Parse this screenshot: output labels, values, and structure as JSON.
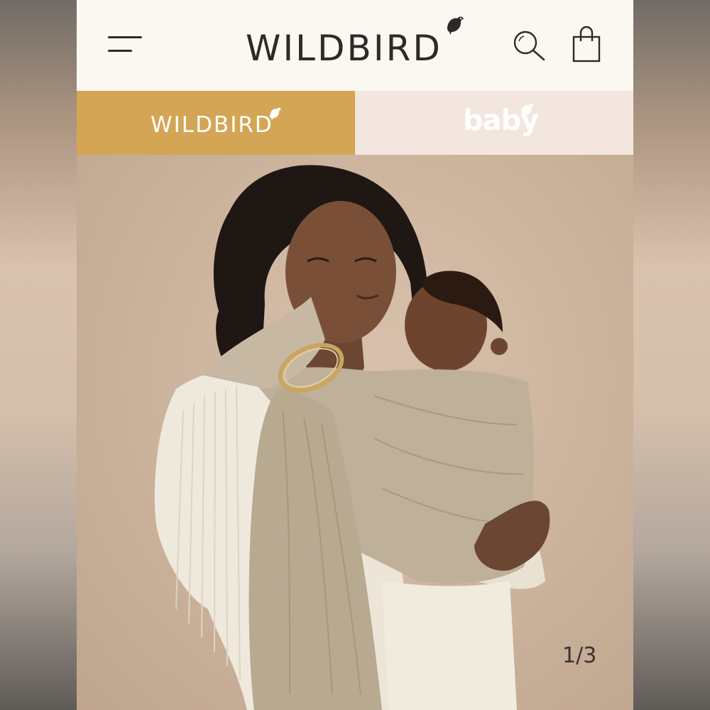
{
  "header": {
    "brand": "WILDBIRD",
    "icons": {
      "menu": "hamburger-menu-icon",
      "search": "search-icon",
      "cart": "shopping-bag-icon"
    }
  },
  "tabs": [
    {
      "label": "WILDBIRD",
      "color": "#d3a554",
      "active": true
    },
    {
      "label": "baby",
      "color": "#f3e6df",
      "active": false
    }
  ],
  "gallery": {
    "counter": "1/3",
    "current": 1,
    "total": 3
  },
  "colors": {
    "header_bg": "#fbf7f1",
    "text_dark": "#2f2a27",
    "gold": "#d3a554",
    "blush": "#f3e6df",
    "sling": "#bfb09a"
  }
}
